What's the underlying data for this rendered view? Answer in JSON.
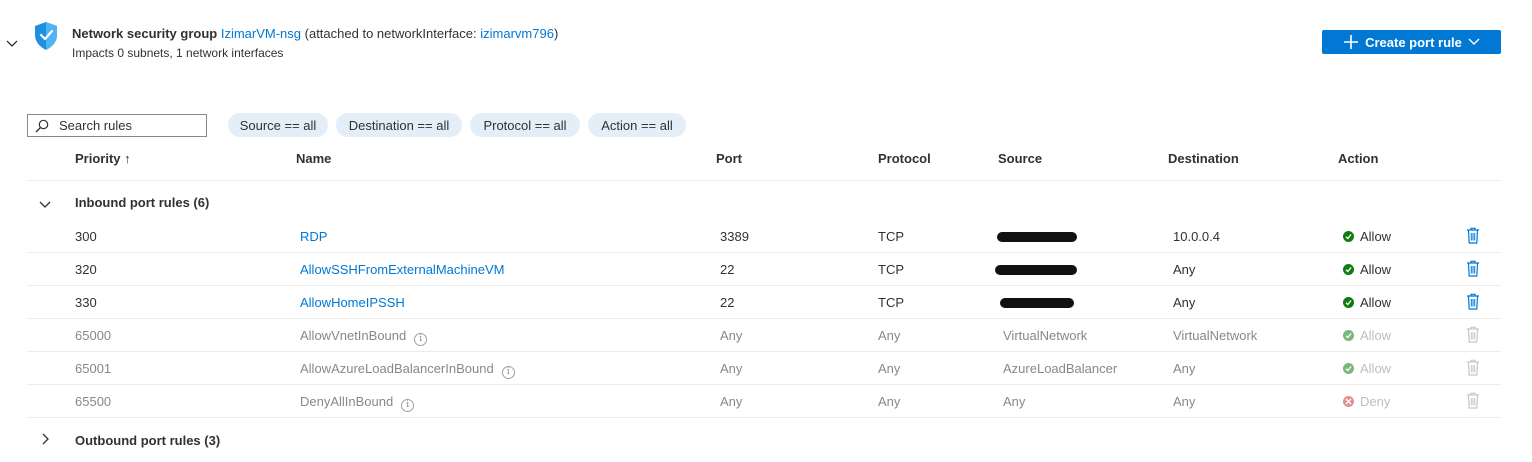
{
  "nsg": {
    "label": "Network security group",
    "name": "IzimarVM-nsg",
    "attached_prefix": "(attached to networkInterface:",
    "interface": "izimarvm796",
    "attached_suffix": ")",
    "impacts": "Impacts 0 subnets, 1 network interfaces"
  },
  "toolbar": {
    "create_label": "Create port rule"
  },
  "search": {
    "placeholder": "Search rules"
  },
  "filters": [
    "Source == all",
    "Destination == all",
    "Protocol == all",
    "Action == all"
  ],
  "columns": {
    "priority": "Priority ↑",
    "name": "Name",
    "port": "Port",
    "protocol": "Protocol",
    "source": "Source",
    "destination": "Destination",
    "action": "Action"
  },
  "inbound": {
    "label": "Inbound port rules (6)",
    "rules": [
      {
        "priority": "300",
        "name": "RDP",
        "port": "3389",
        "protocol": "TCP",
        "source": "",
        "destination": "10.0.0.4",
        "action": "Allow"
      },
      {
        "priority": "320",
        "name": "AllowSSHFromExternalMachineVM",
        "port": "22",
        "protocol": "TCP",
        "source": "",
        "destination": "Any",
        "action": "Allow"
      },
      {
        "priority": "330",
        "name": "AllowHomeIPSSH",
        "port": "22",
        "protocol": "TCP",
        "source": "",
        "destination": "Any",
        "action": "Allow"
      },
      {
        "priority": "65000",
        "name": "AllowVnetInBound",
        "port": "Any",
        "protocol": "Any",
        "source": "VirtualNetwork",
        "destination": "VirtualNetwork",
        "action": "Allow"
      },
      {
        "priority": "65001",
        "name": "AllowAzureLoadBalancerInBound",
        "port": "Any",
        "protocol": "Any",
        "source": "AzureLoadBalancer",
        "destination": "Any",
        "action": "Allow"
      },
      {
        "priority": "65500",
        "name": "DenyAllInBound",
        "port": "Any",
        "protocol": "Any",
        "source": "Any",
        "destination": "Any",
        "action": "Deny"
      }
    ]
  },
  "outbound": {
    "label": "Outbound port rules (3)"
  },
  "colors": {
    "accent": "#0078d4",
    "allow": "#107c10",
    "deny": "#d13438",
    "pill": "#e3eef8"
  }
}
